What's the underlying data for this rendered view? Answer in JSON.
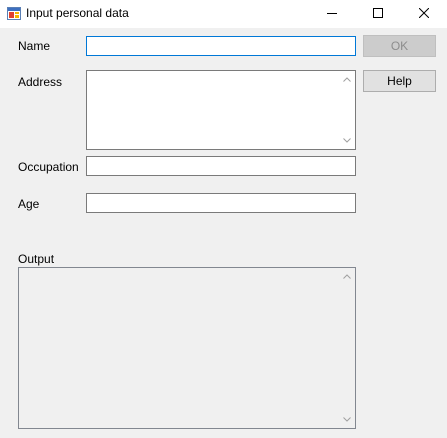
{
  "window": {
    "title": "Input personal data",
    "icon": "app-form-icon"
  },
  "controls": {
    "minimize_icon": "minimize-icon",
    "maximize_icon": "maximize-icon",
    "close_icon": "close-icon"
  },
  "form": {
    "name_label": "Name",
    "name_value": "",
    "address_label": "Address",
    "address_value": "",
    "occupation_label": "Occupation",
    "occupation_value": "",
    "age_label": "Age",
    "age_value": "",
    "output_label": "Output",
    "output_value": ""
  },
  "buttons": {
    "ok_label": "OK",
    "ok_enabled": false,
    "help_label": "Help"
  },
  "colors": {
    "focus_border": "#0078d7",
    "window_bg": "#f0f0f0"
  }
}
